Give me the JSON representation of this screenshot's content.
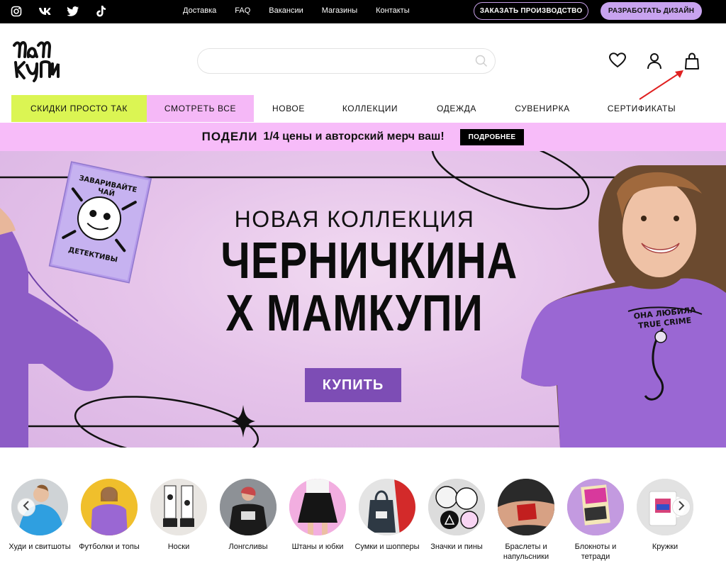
{
  "topbar": {
    "social": [
      {
        "icon": "instagram-icon"
      },
      {
        "icon": "vk-icon"
      },
      {
        "icon": "twitter-icon"
      },
      {
        "icon": "tiktok-icon"
      }
    ],
    "nav": [
      "Доставка",
      "FAQ",
      "Вакансии",
      "Магазины",
      "Контакты"
    ],
    "order_button": "ЗАКАЗАТЬ ПРОИЗВОДСТВО",
    "design_button": "РАЗРАБОТАТЬ ДИЗАЙН"
  },
  "header": {
    "logo_text": "МАМКУПИ",
    "search_placeholder": "",
    "icons": [
      "heart-icon",
      "user-icon",
      "cart-icon"
    ]
  },
  "menu": {
    "items": [
      "СКИДКИ ПРОСТО ТАК",
      "СМОТРЕТЬ ВСЕ",
      "НОВОЕ",
      "КОЛЛЕКЦИИ",
      "ОДЕЖДА",
      "СУВЕНИРКА",
      "СЕРТИФИКАТЫ"
    ]
  },
  "promo": {
    "share": "ПОДЕЛИ",
    "text": "1/4 цены и авторский мерч ваш!",
    "button": "ПОДРОБНЕЕ"
  },
  "hero": {
    "subtitle": "НОВАЯ КОЛЛЕКЦИЯ",
    "title_line1": "ЧЕРНИЧКИНА",
    "title_line2": "Х МАМКУПИ",
    "buy_button": "КУПИТЬ",
    "notebook_text": "ЗАВАРИВАЙТЕ ЧАЙ ДЕТЕКТИВЫ",
    "shirt_text": "ОНА ЛЮБИЛА TRUE CRIME"
  },
  "categories": [
    {
      "label": "Худи и свитшоты"
    },
    {
      "label": "Футболки и топы"
    },
    {
      "label": "Носки"
    },
    {
      "label": "Лонгсливы"
    },
    {
      "label": "Штаны и юбки"
    },
    {
      "label": "Сумки и шопперы"
    },
    {
      "label": "Значки и пины"
    },
    {
      "label": "Браслеты и напульсники"
    },
    {
      "label": "Блокноты и тетради"
    },
    {
      "label": "Кружки"
    }
  ],
  "colors": {
    "sale_bg": "#dbf553",
    "all_bg": "#f5b8f7",
    "promo_bg": "#f7bcf9",
    "accent_purple": "#7d4db5",
    "design_btn": "#c8a3ef",
    "annotation_arrow": "#e02020"
  }
}
